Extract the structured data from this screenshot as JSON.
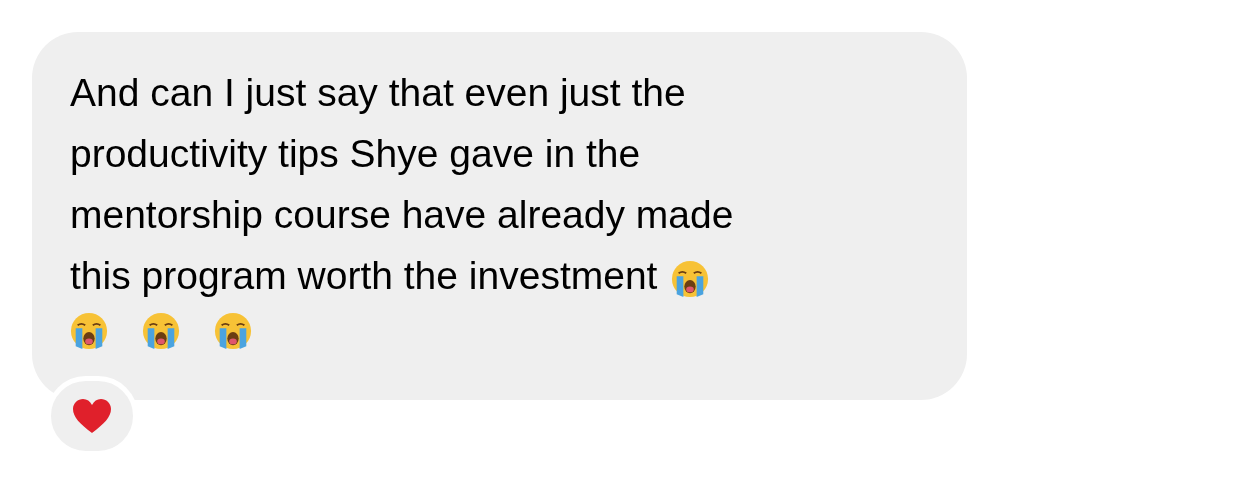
{
  "message": {
    "lines": [
      "And can I just say that even just the",
      "productivity tips Shye gave in the",
      "mentorship course have already made",
      "this program worth the investment"
    ],
    "emojis": [
      {
        "kind": "crying"
      },
      {
        "kind": "crying"
      },
      {
        "kind": "crying"
      },
      {
        "kind": "crying"
      }
    ],
    "reaction": {
      "kind": "heart"
    }
  }
}
